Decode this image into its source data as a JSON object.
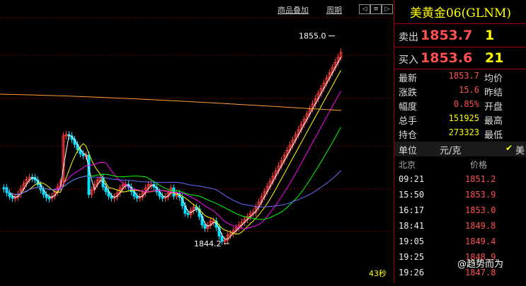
{
  "toolbar": {
    "overlay_label": "商品叠加",
    "period_label": "周期",
    "prev_icon": "◁",
    "menu_icon": "≡",
    "next_icon": "▷"
  },
  "chart": {
    "high_label": "1855.0",
    "low_label": "1844.2",
    "timer": "43秒",
    "colors": {
      "up": "#ff3c3c",
      "down": "#00e0ff",
      "ma_white": "#ffffff",
      "ma_yellow": "#ffff00",
      "ma_magenta": "#ff00ff",
      "ma_green": "#00ff00",
      "ma_blue": "#6a6aff",
      "ma_orange": "#ff9a30",
      "grid": "#7a0000"
    }
  },
  "quote": {
    "title": "美黄金06(GLNM)",
    "sell_label": "卖出",
    "sell_price": "1853.7",
    "sell_vol": "1",
    "buy_label": "买入",
    "buy_price": "1853.6",
    "buy_vol": "21",
    "rows": [
      {
        "k1": "最新",
        "v1": "1853.7",
        "k2": "均价"
      },
      {
        "k1": "涨跌",
        "v1": "15.6",
        "k2": "昨结"
      },
      {
        "k1": "幅度",
        "v1": "0.85%",
        "k2": "开盘"
      },
      {
        "k1": "总手",
        "v1": "151925",
        "k2": "最高"
      },
      {
        "k1": "持仓",
        "v1": "273323",
        "k2": "最低"
      }
    ],
    "unit_label": "单位",
    "unit_value": "元/克",
    "check_icon": "✔",
    "unit_extra": "美"
  },
  "ticks": {
    "head_left": "北京",
    "head_right": "价格",
    "rows": [
      {
        "time": "09:21",
        "price": "1851.2"
      },
      {
        "time": "15:50",
        "price": "1853.9"
      },
      {
        "time": "16:17",
        "price": "1853.0"
      },
      {
        "time": "18:41",
        "price": "1849.8"
      },
      {
        "time": "19:05",
        "price": "1849.4"
      },
      {
        "time": "19:25",
        "price": "1848.9"
      },
      {
        "time": "19:26",
        "price": "1847.8"
      }
    ]
  },
  "watermark": "@趋势而为"
}
